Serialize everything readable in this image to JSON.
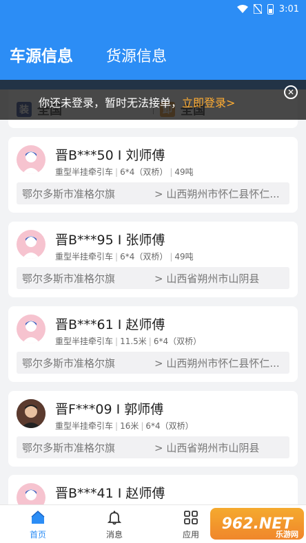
{
  "status_bar": {
    "time": "3:01"
  },
  "tabs": [
    {
      "label": "车源信息",
      "active": true
    },
    {
      "label": "货源信息",
      "active": false
    }
  ],
  "filter": {
    "from_badge": "装",
    "from_label": "全国",
    "to_badge": "卸",
    "to_label": "全国"
  },
  "toast": {
    "message": "你还未登录，暂时无法接单，",
    "link": "立即登录>",
    "close_icon": "close-icon"
  },
  "cards": [
    {
      "title": "晋B***50 I 刘师傅",
      "specs": [
        "重型半挂牵引车",
        "6*4（双桥）",
        "49吨"
      ],
      "from": "鄂尔多斯市准格尔旗",
      "to": "> 山西朔州市怀仁县怀仁...",
      "avatar": "default-avatar"
    },
    {
      "title": "晋B***95 I 张师傅",
      "specs": [
        "重型半挂牵引车",
        "6*4（双桥）",
        "49吨"
      ],
      "from": "鄂尔多斯市准格尔旗",
      "to": "> 山西省朔州市山阴县",
      "avatar": "default-avatar"
    },
    {
      "title": "晋B***61 I 赵师傅",
      "specs": [
        "重型半挂牵引车",
        "11.5米",
        "6*4（双桥）"
      ],
      "from": "鄂尔多斯市准格尔旗",
      "to": "> 山西朔州市怀仁县怀仁...",
      "avatar": "default-avatar"
    },
    {
      "title": "晋F***09 I 郭师傅",
      "specs": [
        "重型半挂牵引车",
        "16米",
        "6*4（双桥）"
      ],
      "from": "鄂尔多斯市准格尔旗",
      "to": "> 山西省朔州市山阴县",
      "avatar": "photo-avatar"
    },
    {
      "title": "晋B***41 I 赵师傅",
      "specs": [],
      "from": "",
      "to": "",
      "avatar": "default-avatar"
    }
  ],
  "bottom_nav": [
    {
      "label": "首页",
      "icon": "home-icon",
      "active": true
    },
    {
      "label": "消息",
      "icon": "bell-icon",
      "active": false
    },
    {
      "label": "应用",
      "icon": "grid-icon",
      "active": false
    }
  ],
  "watermark": {
    "text": "962.NET",
    "sub": "乐游网"
  },
  "colors": {
    "primary": "#2c8df5",
    "link": "#ffad33",
    "from_badge": "#1f3a8a",
    "to_badge": "#e08a1e"
  }
}
